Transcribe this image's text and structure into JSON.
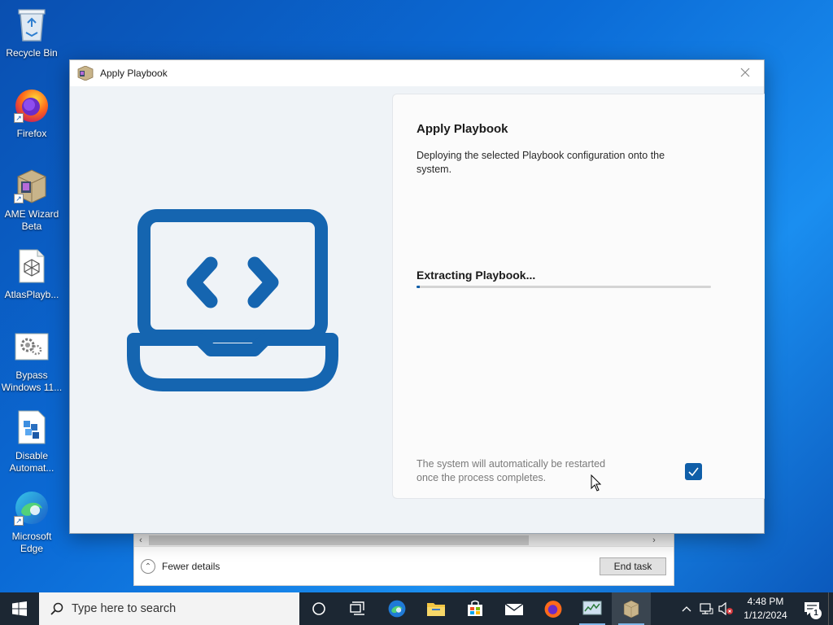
{
  "desktop": {
    "icons": [
      {
        "label": "Recycle Bin"
      },
      {
        "label": "Firefox"
      },
      {
        "label": "AME Wizard Beta"
      },
      {
        "label": "AtlasPlayb..."
      },
      {
        "label": "Bypass Windows 11..."
      },
      {
        "label": "Disable Automat..."
      },
      {
        "label": "Microsoft Edge"
      }
    ]
  },
  "taskmanager": {
    "fewer_details": "Fewer details",
    "end_task": "End task"
  },
  "window": {
    "title": "Apply Playbook",
    "close_icon": "close-icon"
  },
  "panel": {
    "heading": "Apply Playbook",
    "description": "Deploying the selected Playbook configuration onto the system.",
    "status": "Extracting Playbook...",
    "progress": 0.01,
    "note": "The system will automatically be restarted once the process completes.",
    "restart_checked": true
  },
  "taskbar": {
    "search_placeholder": "Type here to search",
    "time": "4:48 PM",
    "date": "1/12/2024",
    "notification_count": "1"
  },
  "colors": {
    "accent": "#0f5ea8",
    "illustration": "#1565b0",
    "taskbar": "#1c2733"
  }
}
